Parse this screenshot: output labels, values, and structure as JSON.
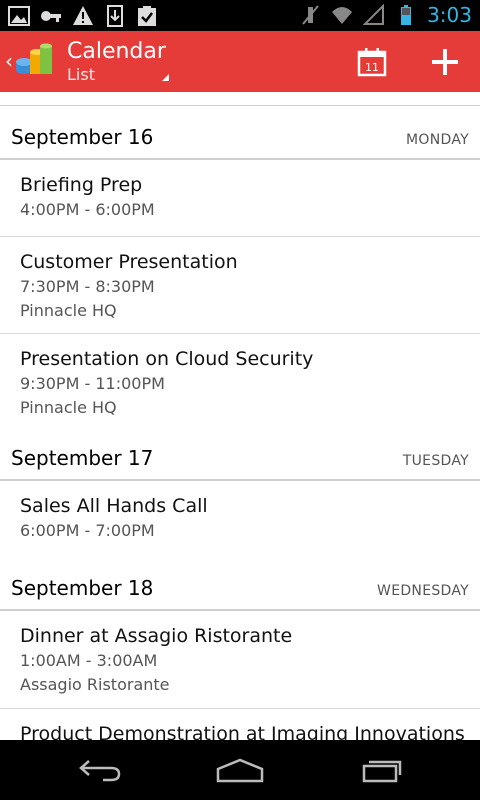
{
  "status_bar": {
    "time": "3:03",
    "left_icons": [
      "image-icon",
      "key-icon",
      "warning-icon",
      "download-icon",
      "clipboard-check-icon"
    ],
    "right_icons": [
      "mute-icon",
      "wifi-icon",
      "signal-icon",
      "battery-icon"
    ],
    "time_color": "#33b5e5"
  },
  "action_bar": {
    "title": "Calendar",
    "subtitle": "List",
    "background": "#e53b39",
    "today_day": "11"
  },
  "sections": [
    {
      "date": "September 16",
      "weekday": "MONDAY",
      "events": [
        {
          "title": "Briefing Prep",
          "time": "4:00PM - 6:00PM",
          "location": ""
        },
        {
          "title": "Customer Presentation",
          "time": "7:30PM - 8:30PM",
          "location": "Pinnacle HQ"
        },
        {
          "title": "Presentation on Cloud Security",
          "time": "9:30PM - 11:00PM",
          "location": "Pinnacle HQ"
        }
      ]
    },
    {
      "date": "September 17",
      "weekday": "TUESDAY",
      "events": [
        {
          "title": "Sales All Hands Call",
          "time": "6:00PM - 7:00PM",
          "location": ""
        }
      ]
    },
    {
      "date": "September 18",
      "weekday": "WEDNESDAY",
      "events": [
        {
          "title": "Dinner at Assagio Ristorante",
          "time": "1:00AM - 3:00AM",
          "location": "Assagio Ristorante"
        },
        {
          "title": "Product Demonstration at Imaging Innovations",
          "time": "",
          "location": ""
        }
      ]
    }
  ],
  "nav_bar": {
    "buttons": [
      "back-icon",
      "home-icon",
      "recent-apps-icon"
    ]
  }
}
